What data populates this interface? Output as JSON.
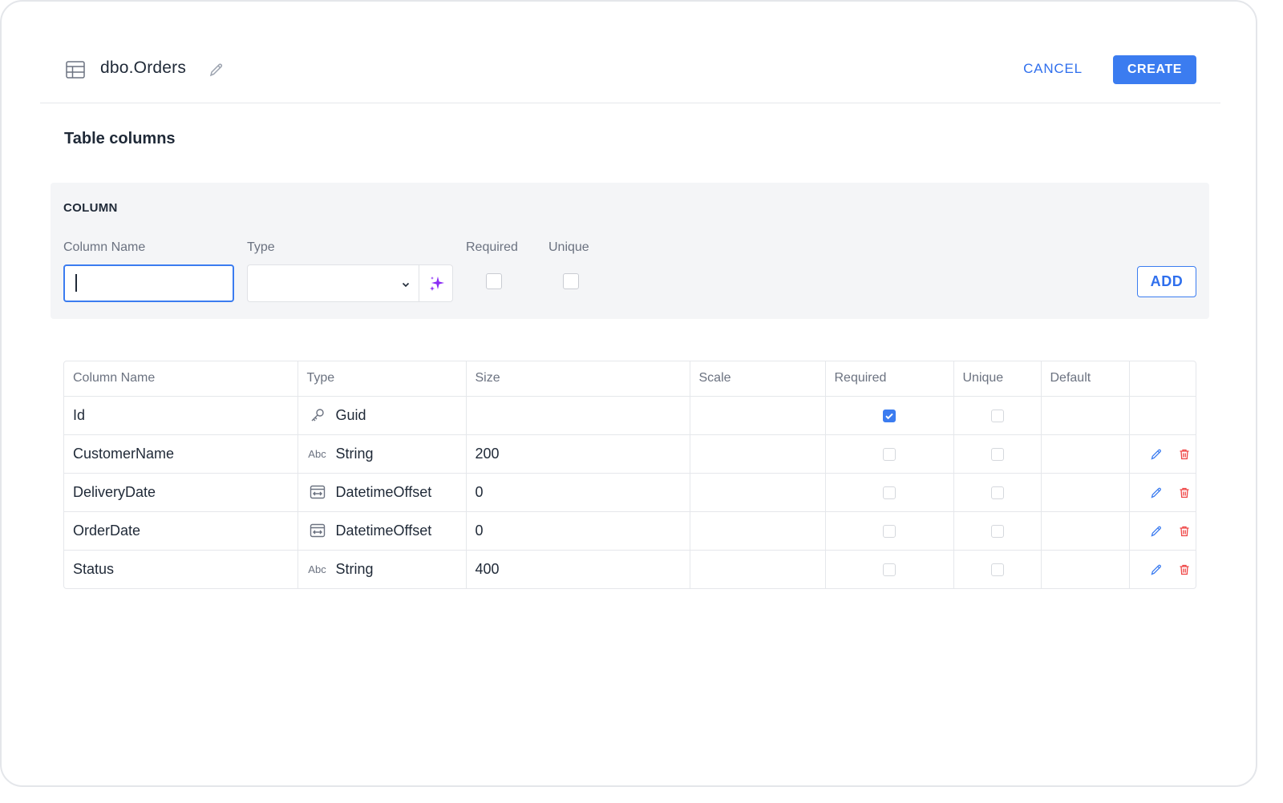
{
  "header": {
    "title": "dbo.Orders",
    "cancel_label": "CANCEL",
    "create_label": "CREATE"
  },
  "section_title": "Table columns",
  "form": {
    "panel_label": "COLUMN",
    "name_label": "Column Name",
    "type_label": "Type",
    "required_label": "Required",
    "unique_label": "Unique",
    "name_value": "",
    "type_value": "",
    "add_label": "ADD"
  },
  "table": {
    "headers": [
      "Column Name",
      "Type",
      "Size",
      "Scale",
      "Required",
      "Unique",
      "Default",
      ""
    ],
    "rows": [
      {
        "name": "Id",
        "type_icon": "key-icon",
        "type": "Guid",
        "size": "",
        "scale": "",
        "required": true,
        "unique": false,
        "default": "",
        "actions": false
      },
      {
        "name": "CustomerName",
        "type_icon": "abc-icon",
        "type_abbr": "Abc",
        "type": "String",
        "size": "200",
        "scale": "",
        "required": false,
        "unique": false,
        "default": "",
        "actions": true
      },
      {
        "name": "DeliveryDate",
        "type_icon": "datetime-icon",
        "type": "DatetimeOffset",
        "size": "0",
        "scale": "",
        "required": false,
        "unique": false,
        "default": "",
        "actions": true
      },
      {
        "name": "OrderDate",
        "type_icon": "datetime-icon",
        "type": "DatetimeOffset",
        "size": "0",
        "scale": "",
        "required": false,
        "unique": false,
        "default": "",
        "actions": true
      },
      {
        "name": "Status",
        "type_icon": "abc-icon",
        "type_abbr": "Abc",
        "type": "String",
        "size": "400",
        "scale": "",
        "required": false,
        "unique": false,
        "default": "",
        "actions": true
      }
    ]
  },
  "colors": {
    "accent": "#3b7cf0",
    "danger": "#ef4444",
    "magic": "#8b2cf5"
  }
}
